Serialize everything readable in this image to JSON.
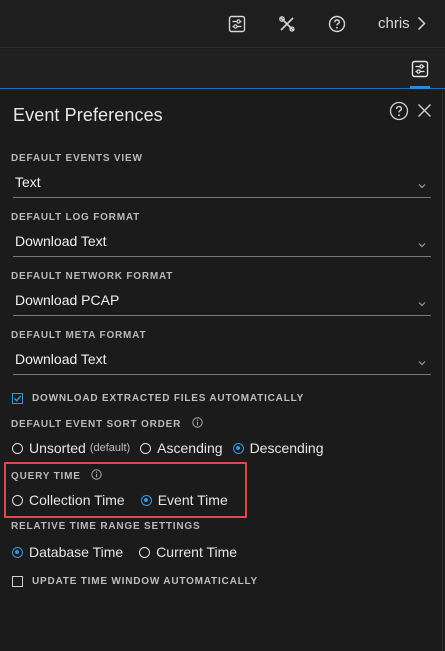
{
  "topbar": {
    "icons": [
      "preferences-icon",
      "tools-icon",
      "help-icon"
    ],
    "user": "chris"
  },
  "panel": {
    "title": "Event Preferences",
    "default_events_view": {
      "label": "DEFAULT EVENTS VIEW",
      "value": "Text"
    },
    "default_log_format": {
      "label": "DEFAULT LOG FORMAT",
      "value": "Download Text"
    },
    "default_network_format": {
      "label": "DEFAULT NETWORK FORMAT",
      "value": "Download PCAP"
    },
    "default_meta_format": {
      "label": "DEFAULT META FORMAT",
      "value": "Download Text"
    },
    "download_extracted": {
      "label": "DOWNLOAD EXTRACTED FILES AUTOMATICALLY",
      "checked": true
    },
    "sort_order": {
      "label": "DEFAULT EVENT SORT ORDER",
      "options": [
        {
          "label": "Unsorted",
          "hint": "(default)",
          "selected": false
        },
        {
          "label": "Ascending",
          "hint": "",
          "selected": false
        },
        {
          "label": "Descending",
          "hint": "",
          "selected": true
        }
      ]
    },
    "query_time": {
      "label": "QUERY TIME",
      "options": [
        {
          "label": "Collection Time",
          "selected": false
        },
        {
          "label": "Event Time",
          "selected": true
        }
      ]
    },
    "relative_time": {
      "label": "RELATIVE TIME RANGE SETTINGS",
      "options": [
        {
          "label": "Database Time",
          "selected": true
        },
        {
          "label": "Current Time",
          "selected": false
        }
      ]
    },
    "update_time_window": {
      "label": "UPDATE TIME WINDOW AUTOMATICALLY",
      "checked": false
    }
  },
  "colors": {
    "accent": "#2e9be3",
    "highlight": "#e0474c",
    "background": "#1b1b1b"
  }
}
